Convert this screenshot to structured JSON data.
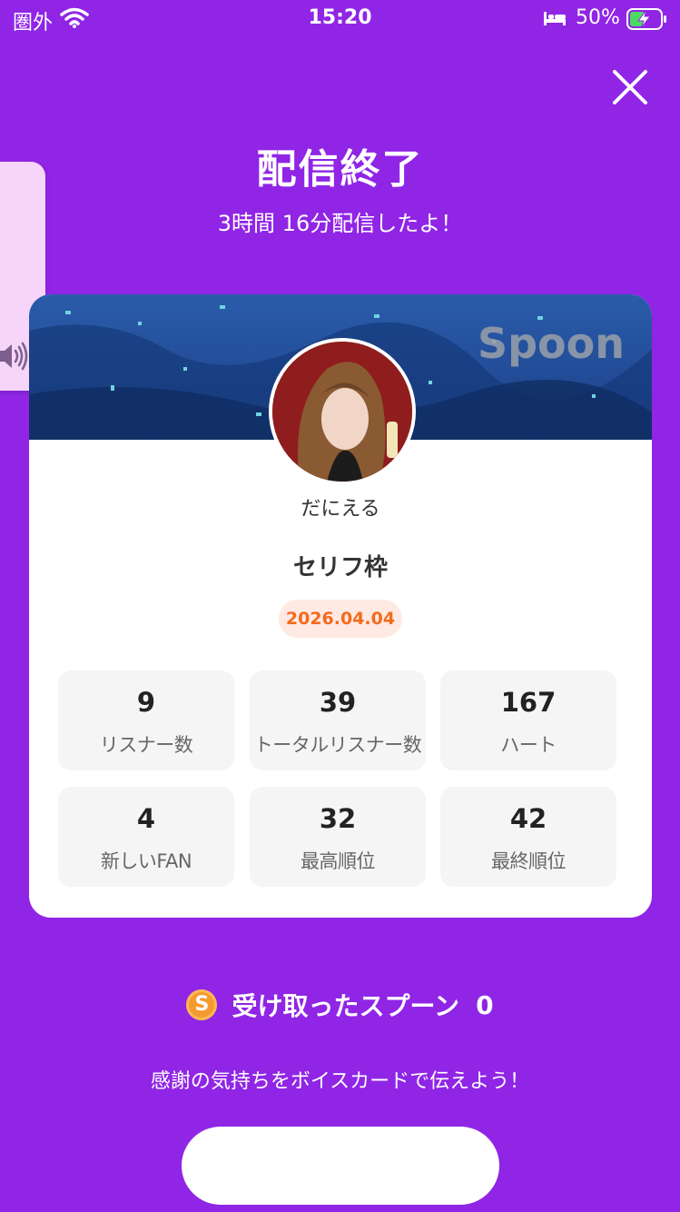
{
  "status_bar": {
    "carrier": "圏外",
    "time": "15:20",
    "battery_percent": "50%",
    "battery_level": 0.5,
    "charging": true
  },
  "header": {
    "close_icon": "close-icon",
    "title": "配信終了",
    "subtitle": "3時間 16分配信したよ！"
  },
  "side_tab": {
    "icon": "speaker-icon"
  },
  "card": {
    "banner_logo": "Spoon",
    "nickname": "だにえる",
    "broadcast_title": "セリフ枠",
    "date": "2026.04.04",
    "stats": [
      {
        "value": "9",
        "label": "リスナー数"
      },
      {
        "value": "39",
        "label": "トータルリスナー数"
      },
      {
        "value": "167",
        "label": "ハート"
      },
      {
        "value": "4",
        "label": "新しいFAN"
      },
      {
        "value": "32",
        "label": "最高順位"
      },
      {
        "value": "42",
        "label": "最終順位"
      }
    ]
  },
  "spoons": {
    "coin_letter": "S",
    "label": "受け取ったスプーン",
    "count": "0"
  },
  "thanks_text": "感謝の気持ちをボイスカードで伝えよう！",
  "colors": {
    "background": "#9025e6",
    "date_badge_bg": "#ffe9e3",
    "date_badge_text": "#f36b1c",
    "coin": "#f59a2f",
    "side_tab": "#f7d4f9"
  }
}
